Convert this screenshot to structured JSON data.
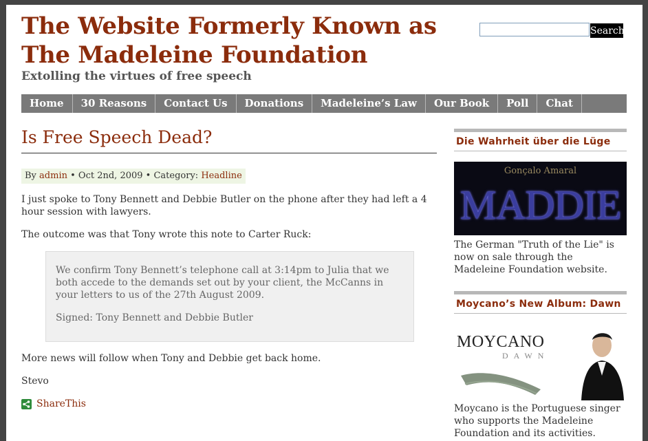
{
  "header": {
    "title_line1": "The Website Formerly Known as",
    "title_line2": "The Madeleine Foundation",
    "tagline": "Extolling the virtues of free speech"
  },
  "search": {
    "button_label": "Search",
    "value": ""
  },
  "nav": {
    "items": [
      "Home",
      "30 Reasons",
      "Contact Us",
      "Donations",
      "Madeleine’s Law",
      "Our Book",
      "Poll",
      "Chat"
    ]
  },
  "post": {
    "title": "Is Free Speech Dead?",
    "meta": {
      "by": "By",
      "author": "admin",
      "date": "• Oct 2nd, 2009 • Category:",
      "category": "Headline"
    },
    "para1": "I just spoke to Tony Bennett and Debbie Butler on the phone after they had left a 4 hour session with lawyers.",
    "para2": "The outcome was that Tony wrote this note to Carter Ruck:",
    "quote": {
      "line1": "We confirm Tony Bennett’s telephone call at 3:14pm to Julia that we both accede to the demands set out by your client, the McCanns in your letters to us of the 27th August 2009.",
      "line2": "Signed: Tony Bennett and Debbie Butler"
    },
    "para3": "More news will follow when Tony and Debbie get back home.",
    "signoff": "Stevo",
    "share_label": "ShareThis"
  },
  "sidebar": {
    "widget1": {
      "title": "Die Wahrheit über die Lüge",
      "image_author": "Gonçalo Amaral",
      "image_word": "MADDIE",
      "text": "The German \"Truth of the Lie\" is now on sale through the Madeleine Foundation website."
    },
    "widget2": {
      "title": "Moycano’s New Album: Dawn",
      "image_name": "MOYCANO",
      "image_sub": "DAWN",
      "text": "Moycano is the Portuguese singer who supports the Madeleine Foundation and its activities."
    }
  },
  "colors": {
    "accent": "#8b2c0c",
    "nav_bg": "#7a7a7a",
    "meta_bg": "#eef5e4",
    "quote_bg": "#f0f0f0",
    "share_green": "#2e8b3a"
  }
}
